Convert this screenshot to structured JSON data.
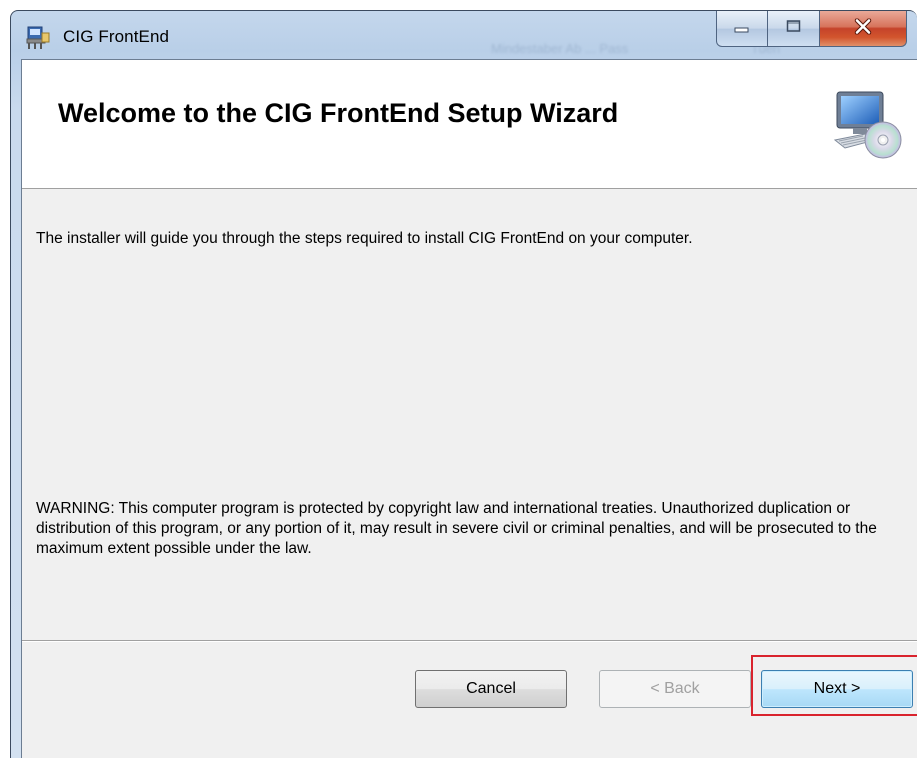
{
  "window": {
    "title": "CIG FrontEnd",
    "background_blur_texts": [
      "Mindestaber Ab ... Pass",
      "Tuen"
    ]
  },
  "banner": {
    "title": "Welcome to the CIG FrontEnd Setup Wizard",
    "icon": "computer-with-cd-icon"
  },
  "body": {
    "intro": "The installer will guide you through the steps required to install CIG FrontEnd on your computer.",
    "warning": "WARNING: This computer program is protected by copyright law and international treaties. Unauthorized duplication or distribution of this program, or any portion of it, may result in severe civil or criminal penalties, and will be prosecuted to the maximum extent possible under the law."
  },
  "buttons": {
    "cancel": "Cancel",
    "back": "< Back",
    "next": "Next >"
  },
  "colors": {
    "highlight": "#d9232d",
    "dialog_bg": "#f0f0f0"
  }
}
